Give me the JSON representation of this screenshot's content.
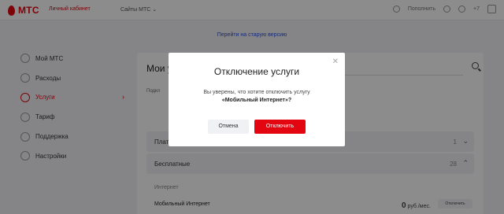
{
  "header": {
    "logo_text": "МТС",
    "cabinet_link": "Личный кабинет",
    "sites_link": "Сайты МТС",
    "right_text": "Пополнить",
    "right_extra": "+7"
  },
  "old_version_link": "Перейти на старую версию",
  "sidebar": {
    "items": [
      {
        "label": "Мой МТС",
        "icon": "home-icon"
      },
      {
        "label": "Расходы",
        "icon": "coins-icon"
      },
      {
        "label": "Услуги",
        "icon": "services-icon",
        "active": true
      },
      {
        "label": "Тариф",
        "icon": "tariff-icon"
      },
      {
        "label": "Поддержка",
        "icon": "support-icon"
      },
      {
        "label": "Настройки",
        "icon": "gear-icon"
      }
    ]
  },
  "main": {
    "title": "Мои у",
    "subtitle": "Подкл",
    "accordion": [
      {
        "label": "Плат",
        "count": "1"
      },
      {
        "label": "Бесплатные",
        "count": "28"
      }
    ],
    "section_label": "Интернет",
    "service_name": "Мобильный Интернет",
    "service_price_value": "0",
    "service_price_unit": "руб./мес.",
    "service_off_button": "Отключить"
  },
  "modal": {
    "title": "Отключение услуги",
    "question_line1": "Вы уверены, что хотите отключить услугу",
    "question_line2": "«Мобильный Интернет»?",
    "cancel_label": "Отмена",
    "confirm_label": "Отключить"
  },
  "colors": {
    "brand_red": "#e30611",
    "link_blue": "#2b4fd2",
    "overlay": "rgba(0,0,0,0.45)"
  }
}
